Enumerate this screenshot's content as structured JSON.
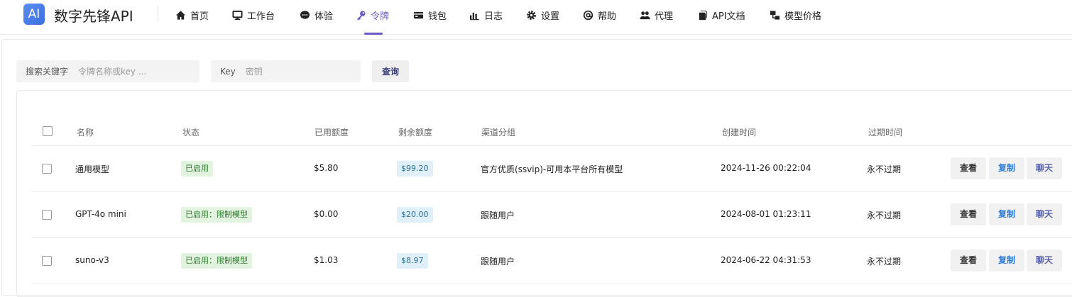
{
  "brand": {
    "logo_text": "AI",
    "name": "数字先锋API"
  },
  "nav": [
    {
      "label": "首页",
      "icon": "home-icon",
      "active": false
    },
    {
      "label": "工作台",
      "icon": "monitor-icon",
      "active": false
    },
    {
      "label": "体验",
      "icon": "chat-bubble-icon",
      "active": false
    },
    {
      "label": "令牌",
      "icon": "key-icon",
      "active": true
    },
    {
      "label": "钱包",
      "icon": "wallet-icon",
      "active": false
    },
    {
      "label": "日志",
      "icon": "bar-chart-icon",
      "active": false
    },
    {
      "label": "设置",
      "icon": "gear-icon",
      "active": false
    },
    {
      "label": "帮助",
      "icon": "at-icon",
      "active": false
    },
    {
      "label": "代理",
      "icon": "users-icon",
      "active": false
    },
    {
      "label": "API文档",
      "icon": "document-icon",
      "active": false
    },
    {
      "label": "模型价格",
      "icon": "sitemap-icon",
      "active": false
    }
  ],
  "search": {
    "keyword_label": "搜索关键字",
    "keyword_placeholder": "令牌名称或key ...",
    "keyword_value": "",
    "key_label": "Key",
    "key_placeholder": "密钥",
    "key_value": "",
    "query_label": "查询"
  },
  "table": {
    "headers": {
      "name": "名称",
      "status": "状态",
      "used": "已用额度",
      "remaining": "剩余额度",
      "group": "渠道分组",
      "created": "创建时间",
      "expires": "过期时间"
    },
    "rows": [
      {
        "name": "通用模型",
        "status": "已启用",
        "used": "$5.80",
        "remaining": "$99.20",
        "group": "官方优质(ssvip)-可用本平台所有模型",
        "created": "2024-11-26 00:22:04",
        "expires": "永不过期"
      },
      {
        "name": "GPT-4o mini",
        "status": "已启用：限制模型",
        "used": "$0.00",
        "remaining": "$20.00",
        "group": "跟随用户",
        "created": "2024-08-01 01:23:11",
        "expires": "永不过期"
      },
      {
        "name": "suno-v3",
        "status": "已启用：限制模型",
        "used": "$1.03",
        "remaining": "$8.97",
        "group": "跟随用户",
        "created": "2024-06-22 04:31:53",
        "expires": "永不过期"
      }
    ],
    "actions": {
      "view": "查看",
      "copy": "复制",
      "chat": "聊天"
    }
  },
  "colors": {
    "accent": "#6b5cc4",
    "status_green": "#e2f3e0",
    "remaining_blue": "#dff0fb",
    "copy_blue": "#2f7bd6"
  }
}
